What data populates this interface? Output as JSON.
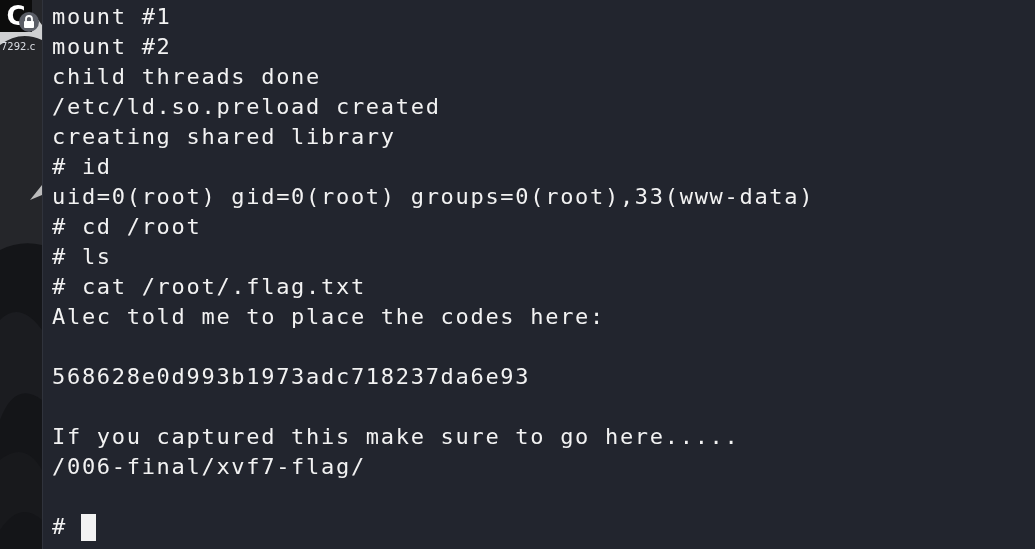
{
  "desktop": {
    "app_icon_letter": "C",
    "locked": true,
    "tab_text": "7292.c"
  },
  "terminal": {
    "lines": [
      {
        "kind": "text",
        "text": "mount #1"
      },
      {
        "kind": "text",
        "text": "mount #2"
      },
      {
        "kind": "text",
        "text": "child threads done"
      },
      {
        "kind": "text",
        "text": "/etc/ld.so.preload created"
      },
      {
        "kind": "text",
        "text": "creating shared library"
      },
      {
        "kind": "text",
        "text": "# id"
      },
      {
        "kind": "text",
        "text": "uid=0(root) gid=0(root) groups=0(root),33(www-data)"
      },
      {
        "kind": "text",
        "text": "# cd /root"
      },
      {
        "kind": "text",
        "text": "# ls"
      },
      {
        "kind": "text",
        "text": "# cat /root/.flag.txt"
      },
      {
        "kind": "text",
        "text": "Alec told me to place the codes here:"
      },
      {
        "kind": "blank"
      },
      {
        "kind": "text",
        "text": "568628e0d993b1973adc718237da6e93"
      },
      {
        "kind": "blank"
      },
      {
        "kind": "text",
        "text": "If you captured this make sure to go here....."
      },
      {
        "kind": "text",
        "text": "/006-final/xvf7-flag/"
      },
      {
        "kind": "blank"
      }
    ],
    "prompt": "#",
    "cursor": true
  }
}
